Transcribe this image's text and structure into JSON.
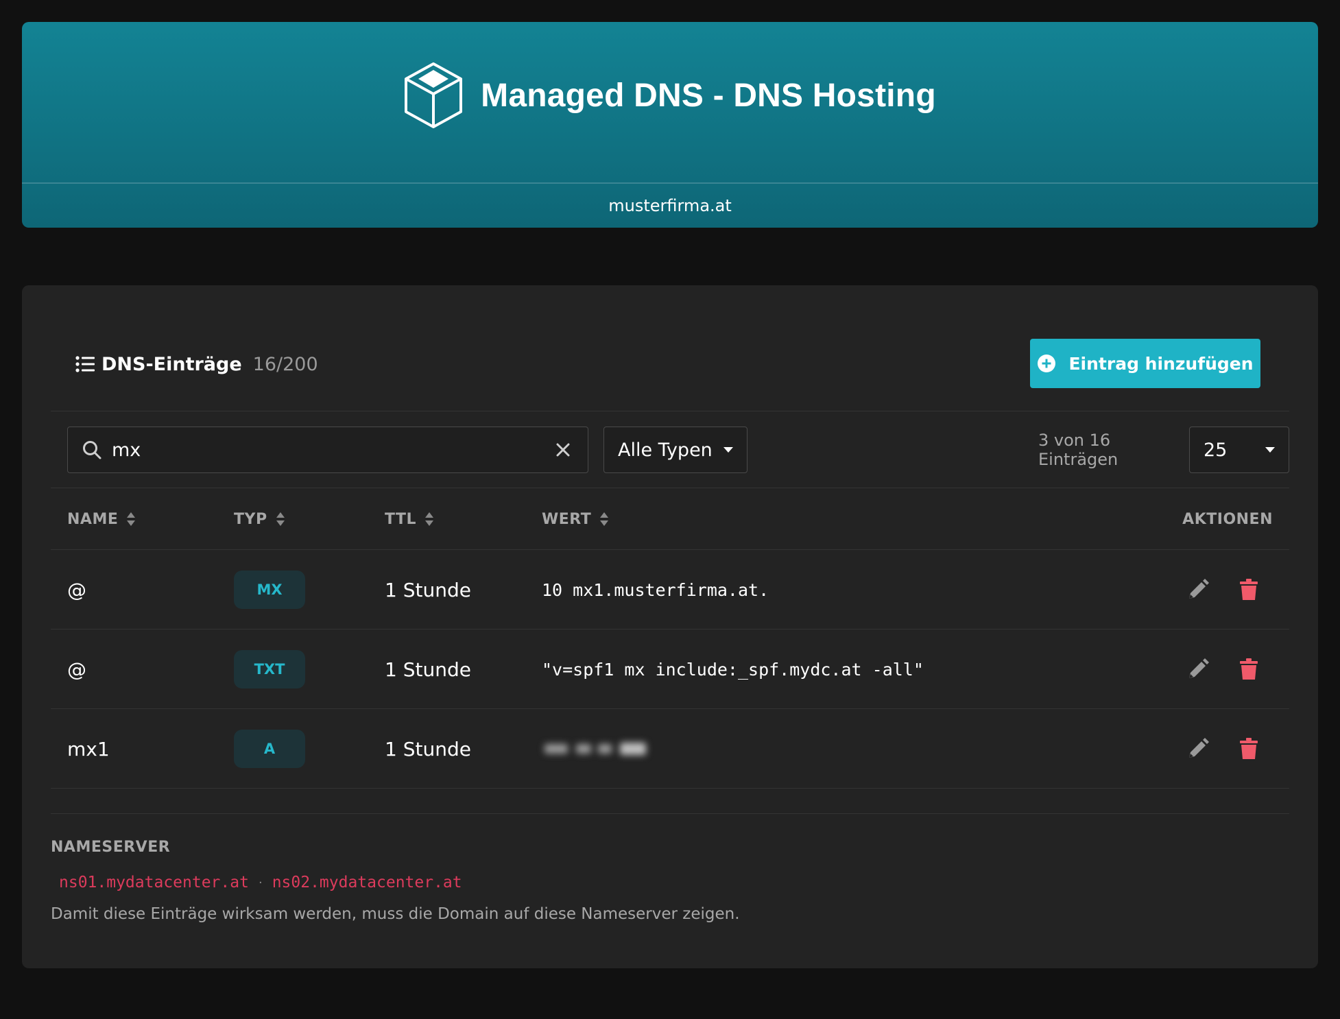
{
  "header": {
    "title": "Managed DNS - DNS Hosting",
    "domain": "musterfirma.at",
    "logo_icon": "cube-icon",
    "gradient_top": "#138394",
    "gradient_bottom": "#0e6676"
  },
  "records_section": {
    "title": "DNS-Einträge",
    "count": "16/200",
    "add_button_label": "Eintrag hinzufügen",
    "accent_color": "#1fb3c6"
  },
  "filters": {
    "search_value": "mx",
    "type_select": "Alle Typen",
    "entries_info": "3 von 16 Einträgen",
    "page_size": "25"
  },
  "table": {
    "columns": {
      "name": "NAME",
      "typ": "TYP",
      "ttl": "TTL",
      "wert": "WERT",
      "aktionen": "AKTIONEN"
    },
    "rows": [
      {
        "name": "@",
        "typ": "MX",
        "ttl": "1 Stunde",
        "wert": "10 mx1.musterfirma.at.",
        "blurred": false
      },
      {
        "name": "@",
        "typ": "TXT",
        "ttl": "1 Stunde",
        "wert": "\"v=spf1 mx include:_spf.mydc.at -all\"",
        "blurred": false
      },
      {
        "name": "mx1",
        "typ": "A",
        "ttl": "1 Stunde",
        "wert": "",
        "blurred": true
      }
    ]
  },
  "nameserver": {
    "heading": "NAMESERVER",
    "servers": [
      "ns01.mydatacenter.at",
      "ns02.mydatacenter.at"
    ],
    "separator": "·",
    "hint": "Damit diese Einträge wirksam werden, muss die Domain auf diese Nameserver zeigen.",
    "server_color": "#dc3b5c"
  }
}
